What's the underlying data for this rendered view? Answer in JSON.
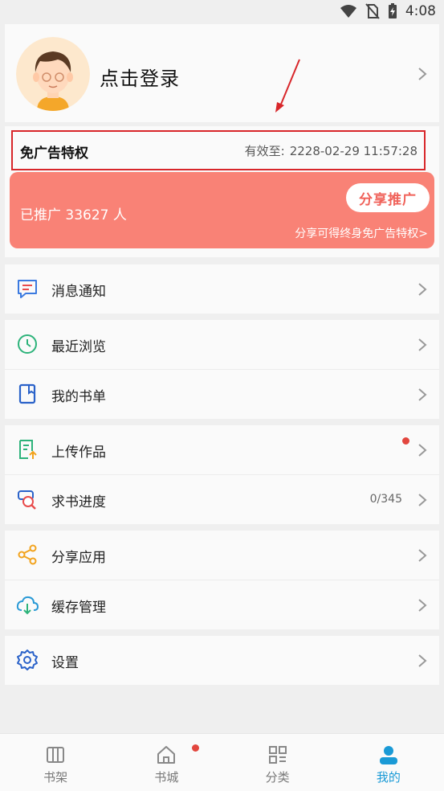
{
  "status_bar": {
    "time": "4:08"
  },
  "profile": {
    "login_text": "点击登录"
  },
  "ad_privilege": {
    "title": "免广告特权",
    "valid_label": "有效至:",
    "valid_until": "2228-02-29 11:57:28"
  },
  "promo": {
    "count_text": "已推广 33627 人",
    "share_button": "分享推广",
    "subtitle": "分享可得终身免广告特权>",
    "color": "#f98276"
  },
  "menu": {
    "notifications": "消息通知",
    "recent": "最近浏览",
    "booklist": "我的书单",
    "upload": "上传作品",
    "request": "求书进度",
    "request_count": "0/345",
    "share_app": "分享应用",
    "cache": "缓存管理",
    "settings": "设置"
  },
  "tabs": [
    {
      "label": "书架",
      "icon": "bookshelf-icon"
    },
    {
      "label": "书城",
      "icon": "home-icon"
    },
    {
      "label": "分类",
      "icon": "category-grid-icon"
    },
    {
      "label": "我的",
      "icon": "user-icon",
      "active": true
    }
  ],
  "colors": {
    "accent": "#1a9ad6",
    "highlight_border": "#d8262a",
    "badge": "#e2463e"
  }
}
